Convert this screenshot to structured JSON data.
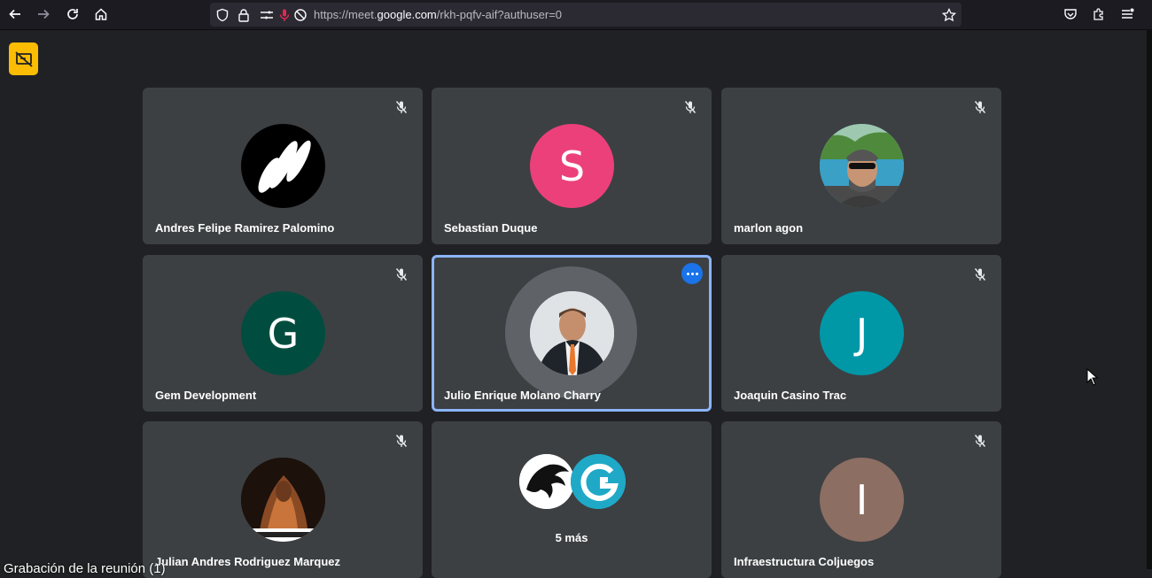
{
  "browser": {
    "url_prefix": "https://meet.",
    "url_host": "google.com",
    "url_suffix": "/rkh-pqfv-aif?authuser=0"
  },
  "colors": {
    "background": "#202124",
    "tile": "#3c4043",
    "active_border": "#8ab4f8",
    "present_badge": "#fbbc04"
  },
  "participants": [
    {
      "name": "Andres Felipe Ramirez Palomino",
      "avatar": "logo",
      "muted": true
    },
    {
      "name": "Sebastian Duque",
      "initial": "S",
      "avatar_color": "#ec407a",
      "muted": true
    },
    {
      "name": "marlon agon",
      "avatar": "photo",
      "muted": true
    },
    {
      "name": "Gem Development",
      "initial": "G",
      "avatar_color": "#004d40",
      "muted": true
    },
    {
      "name": "Julio Enrique Molano Charry",
      "avatar": "photo",
      "speaking": true
    },
    {
      "name": "Joaquin Casino Trac",
      "initial": "J",
      "avatar_color": "#0097a7",
      "muted": true
    },
    {
      "name": "Julian Andres Rodriguez Marquez",
      "avatar": "photo",
      "muted": true
    },
    {
      "more_label": "5 más"
    },
    {
      "name": "Infraestructura Coljuegos",
      "initial": "I",
      "avatar_color": "#8d6e63",
      "muted": true
    }
  ],
  "caption": "Grabación de la reunión (1)"
}
